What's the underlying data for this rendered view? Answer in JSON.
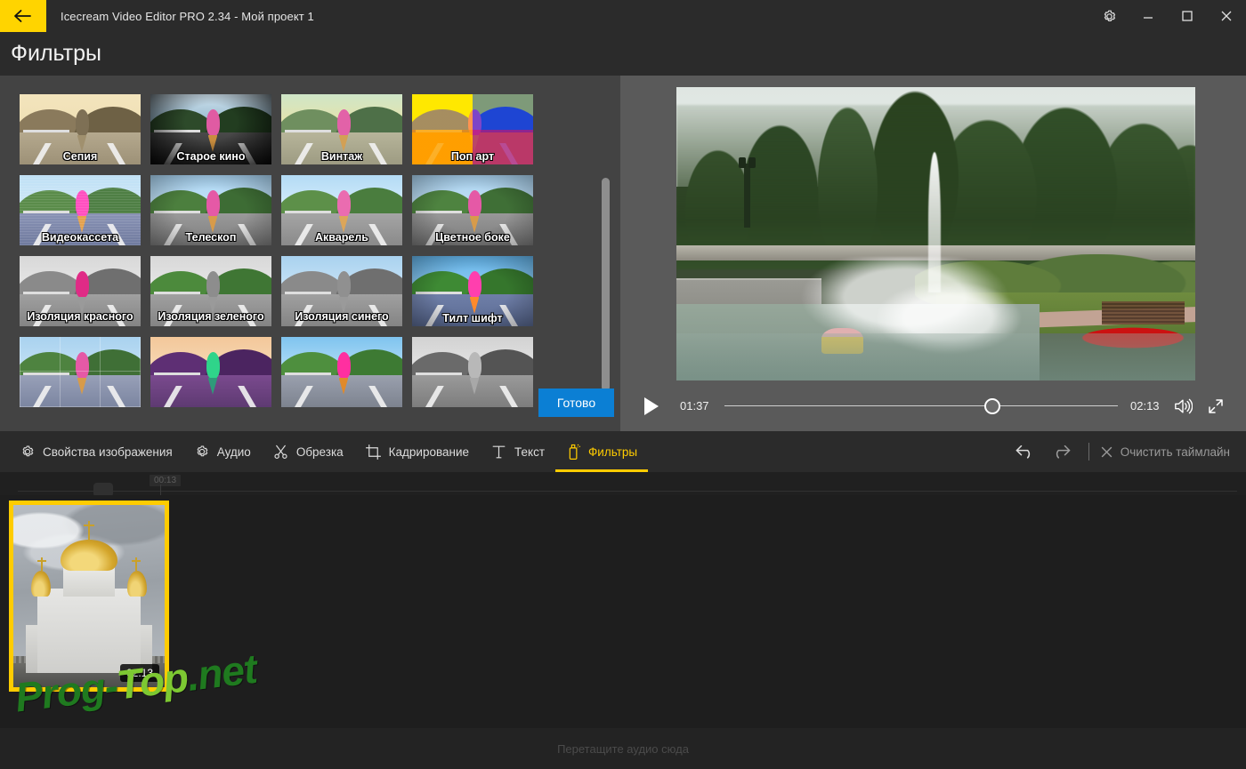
{
  "window": {
    "title": "Icecream Video Editor PRO 2.34  -  Мой проект 1",
    "back_icon": "back-arrow-icon",
    "settings_icon": "gear-icon",
    "minimize_icon": "minimize-icon",
    "maximize_icon": "maximize-icon",
    "close_icon": "close-icon",
    "accent_yellow": "#ffd400"
  },
  "page": {
    "title": "Фильтры"
  },
  "filters": {
    "done_label": "Готово",
    "done_color": "#0b7fd4",
    "items": [
      {
        "label": "Сепия",
        "style": "sepia"
      },
      {
        "label": "Старое кино",
        "style": "oldfilm"
      },
      {
        "label": "Винтаж",
        "style": "vintage"
      },
      {
        "label": "Поп арт",
        "style": "popart"
      },
      {
        "label": "Видеокассета",
        "style": "vhs"
      },
      {
        "label": "Телескоп",
        "style": "telescope"
      },
      {
        "label": "Акварель",
        "style": "watercolor"
      },
      {
        "label": "Цветное боке",
        "style": "bokeh"
      },
      {
        "label": "Изоляция красного",
        "style": "isored"
      },
      {
        "label": "Изоляция зеленого",
        "style": "isogreen"
      },
      {
        "label": "Изоляция синего",
        "style": "isoblue"
      },
      {
        "label": "Тилт шифт",
        "style": "tiltshift"
      },
      {
        "label": "",
        "style": "mirror"
      },
      {
        "label": "",
        "style": "negative"
      },
      {
        "label": "",
        "style": "sharpen"
      },
      {
        "label": "",
        "style": "grayscale"
      }
    ]
  },
  "player": {
    "play_icon": "play-icon",
    "current_time": "01:37",
    "total_time": "02:13",
    "progress_percent": 68,
    "volume_icon": "volume-icon",
    "fullscreen_icon": "fullscreen-icon"
  },
  "toolbar": {
    "tabs": [
      {
        "label": "Свойства изображения",
        "icon": "gear-icon",
        "active": false
      },
      {
        "label": "Аудио",
        "icon": "gear-icon",
        "active": false
      },
      {
        "label": "Обрезка",
        "icon": "scissors-icon",
        "active": false
      },
      {
        "label": "Кадрирование",
        "icon": "crop-icon",
        "active": false
      },
      {
        "label": "Текст",
        "icon": "text-icon",
        "active": false
      },
      {
        "label": "Фильтры",
        "icon": "spray-can-icon",
        "active": true
      }
    ],
    "undo_icon": "undo-icon",
    "redo_icon": "redo-icon",
    "clear_icon": "close-icon",
    "clear_label": "Очистить таймлайн",
    "active_color": "#ffcc00"
  },
  "timeline": {
    "ruler_tooltip": "00:13",
    "clip": {
      "duration": "02:13",
      "selected": true,
      "selection_color": "#ffcc00"
    },
    "audio_hint": "Перетащите аудио сюда"
  },
  "watermark": {
    "text_1": "Prog-",
    "text_2": "Top",
    "text_3": ".net"
  }
}
